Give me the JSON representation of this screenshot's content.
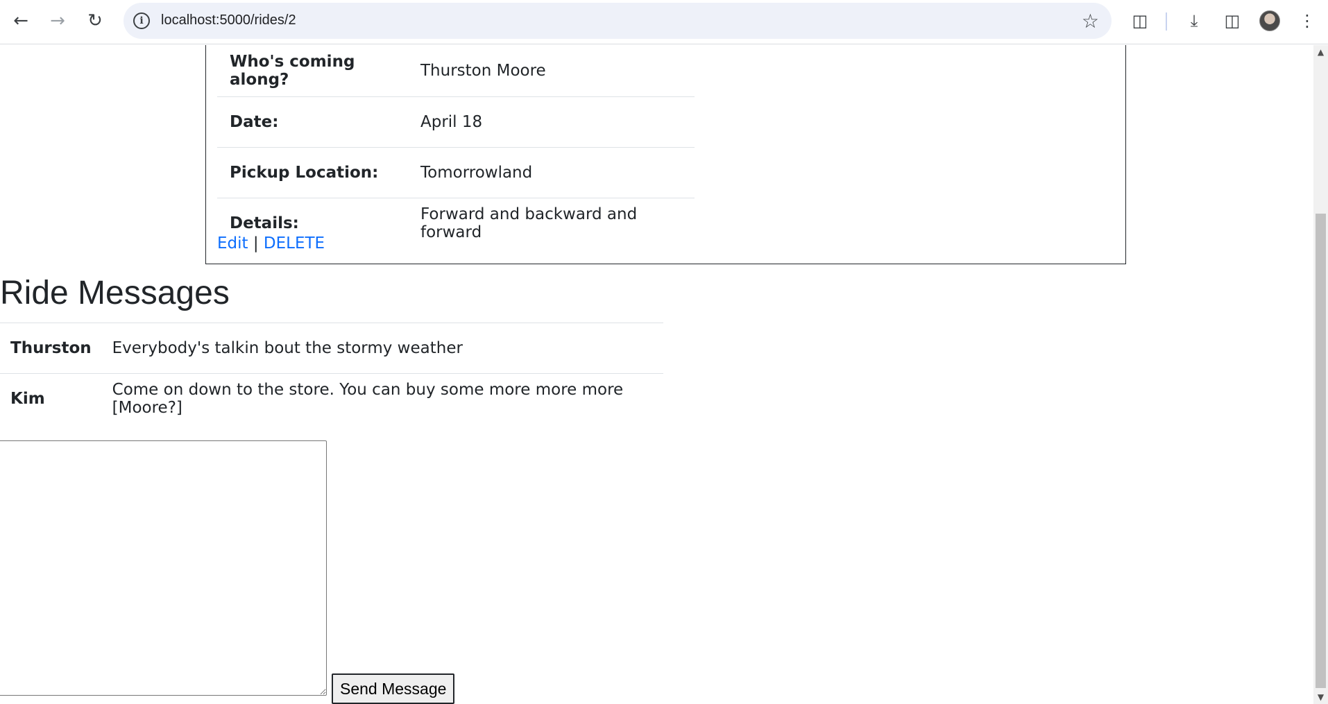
{
  "browser": {
    "url": "localhost:5000/rides/2",
    "back_icon": "arrow-left-icon",
    "forward_icon": "arrow-right-icon",
    "reload_icon": "reload-icon",
    "site_info_icon": "info-icon",
    "bookmark_icon": "star-icon",
    "extensions_icon": "puzzle-icon",
    "download_icon": "download-icon",
    "side_panel_icon": "side-panel-icon",
    "menu_icon": "kebab-menu-icon"
  },
  "ride": {
    "details": [
      {
        "label": "Who's coming along?",
        "value": "Thurston Moore"
      },
      {
        "label": "Date:",
        "value": "April 18"
      },
      {
        "label": "Pickup Location:",
        "value": "Tomorrowland"
      },
      {
        "label": "Details:",
        "value": "Forward and backward and forward"
      }
    ],
    "edit_label": "Edit",
    "separator": "|",
    "delete_label": "DELETE"
  },
  "messages": {
    "heading": "Ride Messages",
    "items": [
      {
        "sender": "Thurston",
        "text": "Everybody's talkin bout the stormy weather"
      },
      {
        "sender": "Kim",
        "text": "Come on down to the store. You can buy some more more more [Moore?]"
      }
    ],
    "input_value": "",
    "send_label": "Send Message"
  }
}
